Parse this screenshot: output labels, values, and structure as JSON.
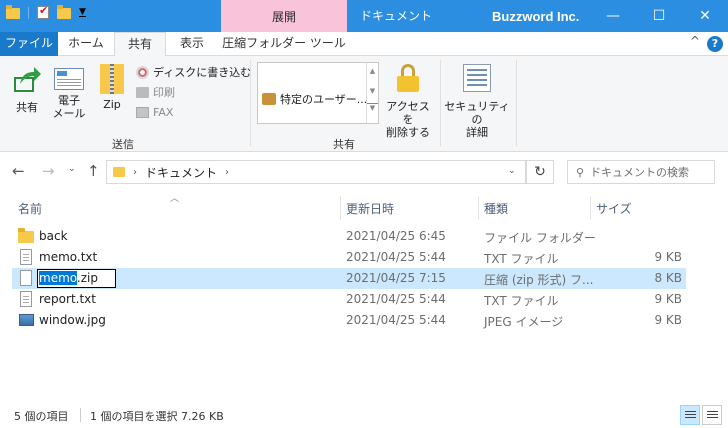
{
  "title_bar": {
    "context_tab": "展開",
    "window_title": "ドキュメント",
    "company": "Buzzword Inc.",
    "minimize": "—",
    "maximize": "☐",
    "close": "✕"
  },
  "tabs": {
    "file": "ファイル",
    "home": "ホーム",
    "share": "共有",
    "view": "表示",
    "compressed_tools": "圧縮フォルダー ツール",
    "collapse_icon": "^",
    "help": "?"
  },
  "ribbon": {
    "share_button": "共有",
    "email_button_line1": "電子",
    "email_button_line2": "メール",
    "zip_button": "Zip",
    "burn_disc": "ディスクに書き込む",
    "print": "印刷",
    "fax": "FAX",
    "send_group": "送信",
    "share_with_item": "特定のユーザー...",
    "remove_access_line1": "アクセスを",
    "remove_access_line2": "削除する",
    "security_line1": "セキュリティの",
    "security_line2": "詳細",
    "share_group": "共有"
  },
  "address": {
    "path": "ドキュメント",
    "search_placeholder": "ドキュメントの検索"
  },
  "columns": {
    "name": "名前",
    "date": "更新日時",
    "type": "種類",
    "size": "サイズ"
  },
  "files": [
    {
      "name": "back",
      "date": "2021/04/25 6:45",
      "type": "ファイル フォルダー",
      "size": "",
      "kind": "folder"
    },
    {
      "name": "memo.txt",
      "date": "2021/04/25 5:44",
      "type": "TXT ファイル",
      "size": "9 KB",
      "kind": "txt"
    },
    {
      "name": "memo.zip",
      "rename_selected": "memo",
      "rename_rest": ".zip",
      "date": "2021/04/25 7:15",
      "type": "圧縮 (zip 形式) フ...",
      "size": "8 KB",
      "kind": "zip"
    },
    {
      "name": "report.txt",
      "date": "2021/04/25 5:44",
      "type": "TXT ファイル",
      "size": "9 KB",
      "kind": "txt"
    },
    {
      "name": "window.jpg",
      "date": "2021/04/25 5:44",
      "type": "JPEG イメージ",
      "size": "9 KB",
      "kind": "jpg"
    }
  ],
  "status": {
    "item_count": "5 個の項目",
    "selection": "1 個の項目を選択  7.26 KB"
  }
}
